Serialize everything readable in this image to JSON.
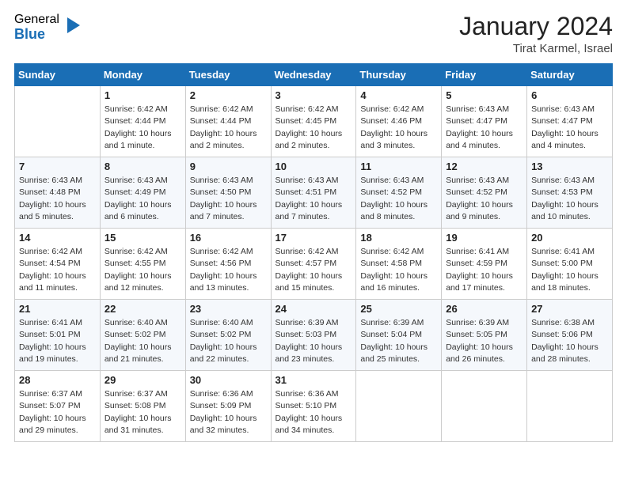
{
  "logo": {
    "general": "General",
    "blue": "Blue"
  },
  "header": {
    "month": "January 2024",
    "location": "Tirat Karmel, Israel"
  },
  "days": [
    "Sunday",
    "Monday",
    "Tuesday",
    "Wednesday",
    "Thursday",
    "Friday",
    "Saturday"
  ],
  "weeks": [
    [
      {
        "day": "",
        "sunrise": "",
        "sunset": "",
        "daylight": ""
      },
      {
        "day": "1",
        "sunrise": "Sunrise: 6:42 AM",
        "sunset": "Sunset: 4:44 PM",
        "daylight": "Daylight: 10 hours and 1 minute."
      },
      {
        "day": "2",
        "sunrise": "Sunrise: 6:42 AM",
        "sunset": "Sunset: 4:44 PM",
        "daylight": "Daylight: 10 hours and 2 minutes."
      },
      {
        "day": "3",
        "sunrise": "Sunrise: 6:42 AM",
        "sunset": "Sunset: 4:45 PM",
        "daylight": "Daylight: 10 hours and 2 minutes."
      },
      {
        "day": "4",
        "sunrise": "Sunrise: 6:42 AM",
        "sunset": "Sunset: 4:46 PM",
        "daylight": "Daylight: 10 hours and 3 minutes."
      },
      {
        "day": "5",
        "sunrise": "Sunrise: 6:43 AM",
        "sunset": "Sunset: 4:47 PM",
        "daylight": "Daylight: 10 hours and 4 minutes."
      },
      {
        "day": "6",
        "sunrise": "Sunrise: 6:43 AM",
        "sunset": "Sunset: 4:47 PM",
        "daylight": "Daylight: 10 hours and 4 minutes."
      }
    ],
    [
      {
        "day": "7",
        "sunrise": "Sunrise: 6:43 AM",
        "sunset": "Sunset: 4:48 PM",
        "daylight": "Daylight: 10 hours and 5 minutes."
      },
      {
        "day": "8",
        "sunrise": "Sunrise: 6:43 AM",
        "sunset": "Sunset: 4:49 PM",
        "daylight": "Daylight: 10 hours and 6 minutes."
      },
      {
        "day": "9",
        "sunrise": "Sunrise: 6:43 AM",
        "sunset": "Sunset: 4:50 PM",
        "daylight": "Daylight: 10 hours and 7 minutes."
      },
      {
        "day": "10",
        "sunrise": "Sunrise: 6:43 AM",
        "sunset": "Sunset: 4:51 PM",
        "daylight": "Daylight: 10 hours and 7 minutes."
      },
      {
        "day": "11",
        "sunrise": "Sunrise: 6:43 AM",
        "sunset": "Sunset: 4:52 PM",
        "daylight": "Daylight: 10 hours and 8 minutes."
      },
      {
        "day": "12",
        "sunrise": "Sunrise: 6:43 AM",
        "sunset": "Sunset: 4:52 PM",
        "daylight": "Daylight: 10 hours and 9 minutes."
      },
      {
        "day": "13",
        "sunrise": "Sunrise: 6:43 AM",
        "sunset": "Sunset: 4:53 PM",
        "daylight": "Daylight: 10 hours and 10 minutes."
      }
    ],
    [
      {
        "day": "14",
        "sunrise": "Sunrise: 6:42 AM",
        "sunset": "Sunset: 4:54 PM",
        "daylight": "Daylight: 10 hours and 11 minutes."
      },
      {
        "day": "15",
        "sunrise": "Sunrise: 6:42 AM",
        "sunset": "Sunset: 4:55 PM",
        "daylight": "Daylight: 10 hours and 12 minutes."
      },
      {
        "day": "16",
        "sunrise": "Sunrise: 6:42 AM",
        "sunset": "Sunset: 4:56 PM",
        "daylight": "Daylight: 10 hours and 13 minutes."
      },
      {
        "day": "17",
        "sunrise": "Sunrise: 6:42 AM",
        "sunset": "Sunset: 4:57 PM",
        "daylight": "Daylight: 10 hours and 15 minutes."
      },
      {
        "day": "18",
        "sunrise": "Sunrise: 6:42 AM",
        "sunset": "Sunset: 4:58 PM",
        "daylight": "Daylight: 10 hours and 16 minutes."
      },
      {
        "day": "19",
        "sunrise": "Sunrise: 6:41 AM",
        "sunset": "Sunset: 4:59 PM",
        "daylight": "Daylight: 10 hours and 17 minutes."
      },
      {
        "day": "20",
        "sunrise": "Sunrise: 6:41 AM",
        "sunset": "Sunset: 5:00 PM",
        "daylight": "Daylight: 10 hours and 18 minutes."
      }
    ],
    [
      {
        "day": "21",
        "sunrise": "Sunrise: 6:41 AM",
        "sunset": "Sunset: 5:01 PM",
        "daylight": "Daylight: 10 hours and 19 minutes."
      },
      {
        "day": "22",
        "sunrise": "Sunrise: 6:40 AM",
        "sunset": "Sunset: 5:02 PM",
        "daylight": "Daylight: 10 hours and 21 minutes."
      },
      {
        "day": "23",
        "sunrise": "Sunrise: 6:40 AM",
        "sunset": "Sunset: 5:02 PM",
        "daylight": "Daylight: 10 hours and 22 minutes."
      },
      {
        "day": "24",
        "sunrise": "Sunrise: 6:39 AM",
        "sunset": "Sunset: 5:03 PM",
        "daylight": "Daylight: 10 hours and 23 minutes."
      },
      {
        "day": "25",
        "sunrise": "Sunrise: 6:39 AM",
        "sunset": "Sunset: 5:04 PM",
        "daylight": "Daylight: 10 hours and 25 minutes."
      },
      {
        "day": "26",
        "sunrise": "Sunrise: 6:39 AM",
        "sunset": "Sunset: 5:05 PM",
        "daylight": "Daylight: 10 hours and 26 minutes."
      },
      {
        "day": "27",
        "sunrise": "Sunrise: 6:38 AM",
        "sunset": "Sunset: 5:06 PM",
        "daylight": "Daylight: 10 hours and 28 minutes."
      }
    ],
    [
      {
        "day": "28",
        "sunrise": "Sunrise: 6:37 AM",
        "sunset": "Sunset: 5:07 PM",
        "daylight": "Daylight: 10 hours and 29 minutes."
      },
      {
        "day": "29",
        "sunrise": "Sunrise: 6:37 AM",
        "sunset": "Sunset: 5:08 PM",
        "daylight": "Daylight: 10 hours and 31 minutes."
      },
      {
        "day": "30",
        "sunrise": "Sunrise: 6:36 AM",
        "sunset": "Sunset: 5:09 PM",
        "daylight": "Daylight: 10 hours and 32 minutes."
      },
      {
        "day": "31",
        "sunrise": "Sunrise: 6:36 AM",
        "sunset": "Sunset: 5:10 PM",
        "daylight": "Daylight: 10 hours and 34 minutes."
      },
      {
        "day": "",
        "sunrise": "",
        "sunset": "",
        "daylight": ""
      },
      {
        "day": "",
        "sunrise": "",
        "sunset": "",
        "daylight": ""
      },
      {
        "day": "",
        "sunrise": "",
        "sunset": "",
        "daylight": ""
      }
    ]
  ]
}
